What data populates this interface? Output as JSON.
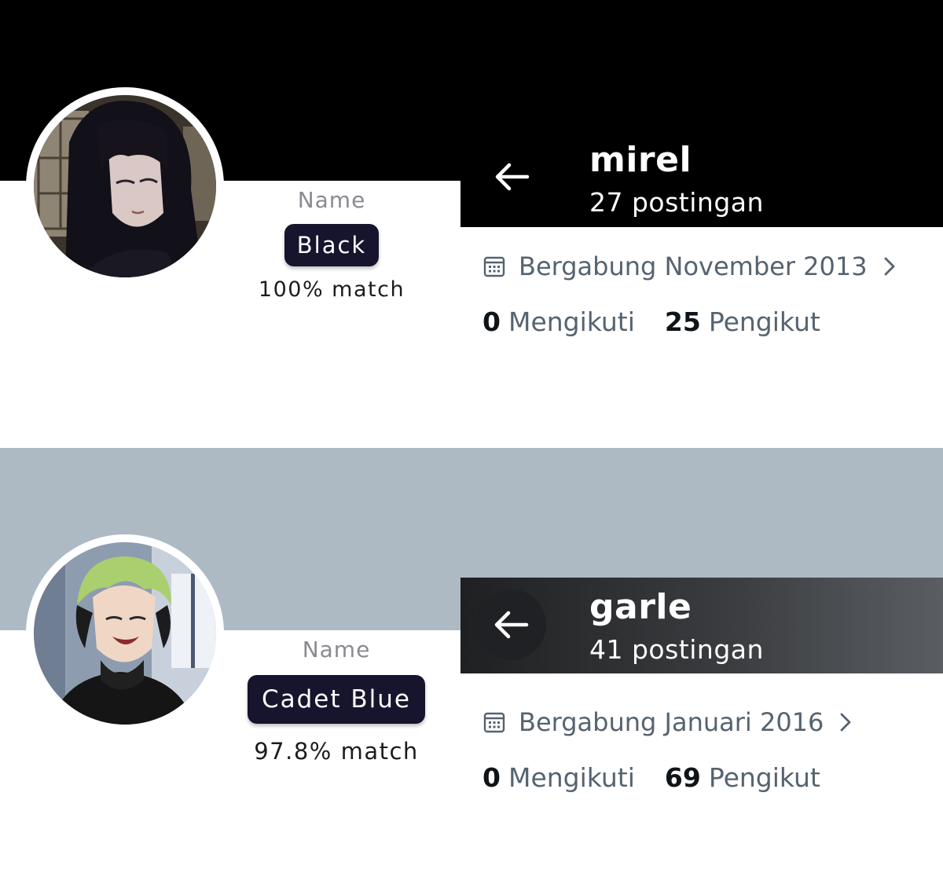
{
  "profiles": [
    {
      "banner_color": "#000000",
      "avatar": "anime-girl-long-black-hair",
      "name_label": "Name",
      "color_name": "Black",
      "match": "100% match",
      "profile_name": "mirel",
      "posts": "27 postingan",
      "joined": "Bergabung November 2013",
      "following_count": "0",
      "following_label": "Mengikuti",
      "followers_count": "25",
      "followers_label": "Pengikut"
    },
    {
      "banner_color": "#adb9c3",
      "avatar": "anime-boy-green-hair-black-hoodie",
      "name_label": "Name",
      "color_name": "Cadet Blue",
      "match": "97.8% match",
      "profile_name": "garle",
      "posts": "41 postingan",
      "joined": "Bergabung Januari 2016",
      "following_count": "0",
      "following_label": "Mengikuti",
      "followers_count": "69",
      "followers_label": "Pengikut"
    }
  ],
  "icons": {
    "back": "arrow-left-icon",
    "calendar": "calendar-icon",
    "chevron": "chevron-right-icon"
  }
}
